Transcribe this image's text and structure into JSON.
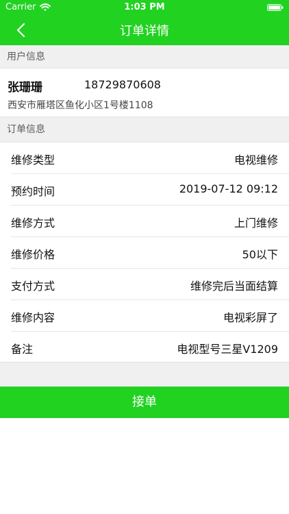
{
  "status_bar": {
    "carrier": "Carrier",
    "time": "1:03 PM"
  },
  "nav": {
    "title": "订单详情"
  },
  "user_section": {
    "header": "用户信息",
    "name": "张珊珊",
    "phone": "18729870608",
    "address": "西安市雁塔区鱼化小区1号楼1108"
  },
  "order_section": {
    "header": "订单信息",
    "rows": [
      {
        "label": "维修类型",
        "value": "电视维修"
      },
      {
        "label": "预约时间",
        "value": "2019-07-12 09:12"
      },
      {
        "label": "维修方式",
        "value": "上门维修"
      },
      {
        "label": "维修价格",
        "value": "50以下"
      },
      {
        "label": "支付方式",
        "value": "维修完后当面结算"
      },
      {
        "label": "维修内容",
        "value": "电视彩屏了"
      },
      {
        "label": "备注",
        "value": "电视型号三星V1209"
      }
    ]
  },
  "actions": {
    "accept_label": "接单"
  },
  "colors": {
    "brand": "#21d221",
    "section_bg": "#f0f0f0"
  },
  "icons": {
    "back": "chevron-left-icon",
    "wifi": "wifi-icon",
    "battery": "battery-icon"
  }
}
